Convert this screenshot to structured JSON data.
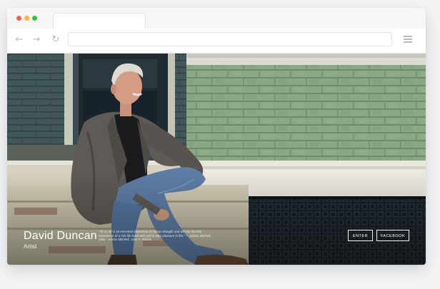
{
  "browser": {
    "url": "",
    "controls": {
      "back_icon": "arrow-left-icon",
      "forward_icon": "arrow-right-icon",
      "reload_icon": "reload-icon",
      "menu_icon": "hamburger-icon"
    }
  },
  "hero": {
    "name": "David Duncan",
    "role": "Artist",
    "quote": "\"To us art is an essential dimension of human thought and we can feel the experience of a rich life lived with and to take pleasure in life.\" — Adrian Mitchell, 1994 · Adrian Mitchell, Jane F. Ritchie",
    "buttons": {
      "enter": "ENTER",
      "facebook": "FACEBOOK"
    }
  },
  "colors": {
    "siding_green": "#8aa483",
    "siding_blue": "#3f5558",
    "grate": "#232b31",
    "step": "#cbc4ad"
  }
}
